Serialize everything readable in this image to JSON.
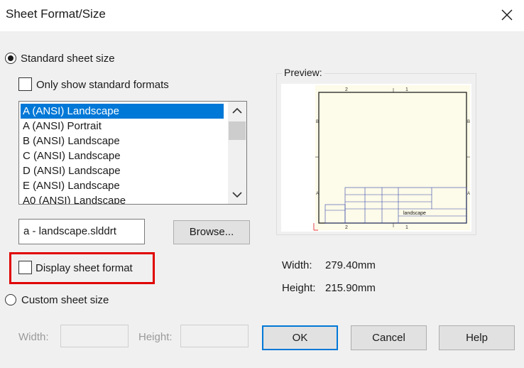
{
  "dialog": {
    "title": "Sheet Format/Size"
  },
  "standard": {
    "radio_label": "Standard sheet size",
    "selected": true,
    "only_standard_label": "Only show standard formats",
    "only_standard_checked": false,
    "formats": [
      "A (ANSI) Landscape",
      "A (ANSI) Portrait",
      "B (ANSI) Landscape",
      "C (ANSI) Landscape",
      "D (ANSI) Landscape",
      "E (ANSI) Landscape",
      "A0 (ANSI) Landscape"
    ],
    "selected_format": "A (ANSI) Landscape",
    "format_file": "a - landscape.slddrt",
    "browse_label": "Browse...",
    "display_format_label": "Display sheet format",
    "display_format_checked": false
  },
  "preview": {
    "label": "Preview:",
    "zone_top": [
      "2",
      "1"
    ],
    "zone_bottom": [
      "2",
      "1"
    ],
    "zone_left": [
      "B",
      "A"
    ],
    "zone_right": [
      "B",
      "A"
    ],
    "title_block_text": "landscape",
    "width_label": "Width:",
    "width_value": "279.40mm",
    "height_label": "Height:",
    "height_value": "215.90mm"
  },
  "custom": {
    "radio_label": "Custom sheet size",
    "selected": false,
    "width_label": "Width:",
    "height_label": "Height:"
  },
  "buttons": {
    "ok": "OK",
    "cancel": "Cancel",
    "help": "Help"
  },
  "colors": {
    "selection": "#0078d7",
    "highlight_box": "#e00000"
  },
  "icons": {
    "close": "close-icon",
    "scroll_up": "chevron-up-icon",
    "scroll_down": "chevron-down-icon"
  }
}
